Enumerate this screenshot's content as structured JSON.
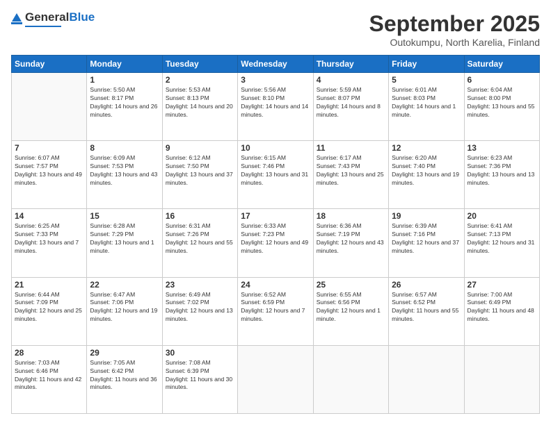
{
  "header": {
    "logo_general": "General",
    "logo_blue": "Blue",
    "month_year": "September 2025",
    "location": "Outokumpu, North Karelia, Finland"
  },
  "days_of_week": [
    "Sunday",
    "Monday",
    "Tuesday",
    "Wednesday",
    "Thursday",
    "Friday",
    "Saturday"
  ],
  "weeks": [
    [
      {
        "day": "",
        "sunrise": "",
        "sunset": "",
        "daylight": ""
      },
      {
        "day": "1",
        "sunrise": "Sunrise: 5:50 AM",
        "sunset": "Sunset: 8:17 PM",
        "daylight": "Daylight: 14 hours and 26 minutes."
      },
      {
        "day": "2",
        "sunrise": "Sunrise: 5:53 AM",
        "sunset": "Sunset: 8:13 PM",
        "daylight": "Daylight: 14 hours and 20 minutes."
      },
      {
        "day": "3",
        "sunrise": "Sunrise: 5:56 AM",
        "sunset": "Sunset: 8:10 PM",
        "daylight": "Daylight: 14 hours and 14 minutes."
      },
      {
        "day": "4",
        "sunrise": "Sunrise: 5:59 AM",
        "sunset": "Sunset: 8:07 PM",
        "daylight": "Daylight: 14 hours and 8 minutes."
      },
      {
        "day": "5",
        "sunrise": "Sunrise: 6:01 AM",
        "sunset": "Sunset: 8:03 PM",
        "daylight": "Daylight: 14 hours and 1 minute."
      },
      {
        "day": "6",
        "sunrise": "Sunrise: 6:04 AM",
        "sunset": "Sunset: 8:00 PM",
        "daylight": "Daylight: 13 hours and 55 minutes."
      }
    ],
    [
      {
        "day": "7",
        "sunrise": "Sunrise: 6:07 AM",
        "sunset": "Sunset: 7:57 PM",
        "daylight": "Daylight: 13 hours and 49 minutes."
      },
      {
        "day": "8",
        "sunrise": "Sunrise: 6:09 AM",
        "sunset": "Sunset: 7:53 PM",
        "daylight": "Daylight: 13 hours and 43 minutes."
      },
      {
        "day": "9",
        "sunrise": "Sunrise: 6:12 AM",
        "sunset": "Sunset: 7:50 PM",
        "daylight": "Daylight: 13 hours and 37 minutes."
      },
      {
        "day": "10",
        "sunrise": "Sunrise: 6:15 AM",
        "sunset": "Sunset: 7:46 PM",
        "daylight": "Daylight: 13 hours and 31 minutes."
      },
      {
        "day": "11",
        "sunrise": "Sunrise: 6:17 AM",
        "sunset": "Sunset: 7:43 PM",
        "daylight": "Daylight: 13 hours and 25 minutes."
      },
      {
        "day": "12",
        "sunrise": "Sunrise: 6:20 AM",
        "sunset": "Sunset: 7:40 PM",
        "daylight": "Daylight: 13 hours and 19 minutes."
      },
      {
        "day": "13",
        "sunrise": "Sunrise: 6:23 AM",
        "sunset": "Sunset: 7:36 PM",
        "daylight": "Daylight: 13 hours and 13 minutes."
      }
    ],
    [
      {
        "day": "14",
        "sunrise": "Sunrise: 6:25 AM",
        "sunset": "Sunset: 7:33 PM",
        "daylight": "Daylight: 13 hours and 7 minutes."
      },
      {
        "day": "15",
        "sunrise": "Sunrise: 6:28 AM",
        "sunset": "Sunset: 7:29 PM",
        "daylight": "Daylight: 13 hours and 1 minute."
      },
      {
        "day": "16",
        "sunrise": "Sunrise: 6:31 AM",
        "sunset": "Sunset: 7:26 PM",
        "daylight": "Daylight: 12 hours and 55 minutes."
      },
      {
        "day": "17",
        "sunrise": "Sunrise: 6:33 AM",
        "sunset": "Sunset: 7:23 PM",
        "daylight": "Daylight: 12 hours and 49 minutes."
      },
      {
        "day": "18",
        "sunrise": "Sunrise: 6:36 AM",
        "sunset": "Sunset: 7:19 PM",
        "daylight": "Daylight: 12 hours and 43 minutes."
      },
      {
        "day": "19",
        "sunrise": "Sunrise: 6:39 AM",
        "sunset": "Sunset: 7:16 PM",
        "daylight": "Daylight: 12 hours and 37 minutes."
      },
      {
        "day": "20",
        "sunrise": "Sunrise: 6:41 AM",
        "sunset": "Sunset: 7:13 PM",
        "daylight": "Daylight: 12 hours and 31 minutes."
      }
    ],
    [
      {
        "day": "21",
        "sunrise": "Sunrise: 6:44 AM",
        "sunset": "Sunset: 7:09 PM",
        "daylight": "Daylight: 12 hours and 25 minutes."
      },
      {
        "day": "22",
        "sunrise": "Sunrise: 6:47 AM",
        "sunset": "Sunset: 7:06 PM",
        "daylight": "Daylight: 12 hours and 19 minutes."
      },
      {
        "day": "23",
        "sunrise": "Sunrise: 6:49 AM",
        "sunset": "Sunset: 7:02 PM",
        "daylight": "Daylight: 12 hours and 13 minutes."
      },
      {
        "day": "24",
        "sunrise": "Sunrise: 6:52 AM",
        "sunset": "Sunset: 6:59 PM",
        "daylight": "Daylight: 12 hours and 7 minutes."
      },
      {
        "day": "25",
        "sunrise": "Sunrise: 6:55 AM",
        "sunset": "Sunset: 6:56 PM",
        "daylight": "Daylight: 12 hours and 1 minute."
      },
      {
        "day": "26",
        "sunrise": "Sunrise: 6:57 AM",
        "sunset": "Sunset: 6:52 PM",
        "daylight": "Daylight: 11 hours and 55 minutes."
      },
      {
        "day": "27",
        "sunrise": "Sunrise: 7:00 AM",
        "sunset": "Sunset: 6:49 PM",
        "daylight": "Daylight: 11 hours and 48 minutes."
      }
    ],
    [
      {
        "day": "28",
        "sunrise": "Sunrise: 7:03 AM",
        "sunset": "Sunset: 6:46 PM",
        "daylight": "Daylight: 11 hours and 42 minutes."
      },
      {
        "day": "29",
        "sunrise": "Sunrise: 7:05 AM",
        "sunset": "Sunset: 6:42 PM",
        "daylight": "Daylight: 11 hours and 36 minutes."
      },
      {
        "day": "30",
        "sunrise": "Sunrise: 7:08 AM",
        "sunset": "Sunset: 6:39 PM",
        "daylight": "Daylight: 11 hours and 30 minutes."
      },
      {
        "day": "",
        "sunrise": "",
        "sunset": "",
        "daylight": ""
      },
      {
        "day": "",
        "sunrise": "",
        "sunset": "",
        "daylight": ""
      },
      {
        "day": "",
        "sunrise": "",
        "sunset": "",
        "daylight": ""
      },
      {
        "day": "",
        "sunrise": "",
        "sunset": "",
        "daylight": ""
      }
    ]
  ]
}
